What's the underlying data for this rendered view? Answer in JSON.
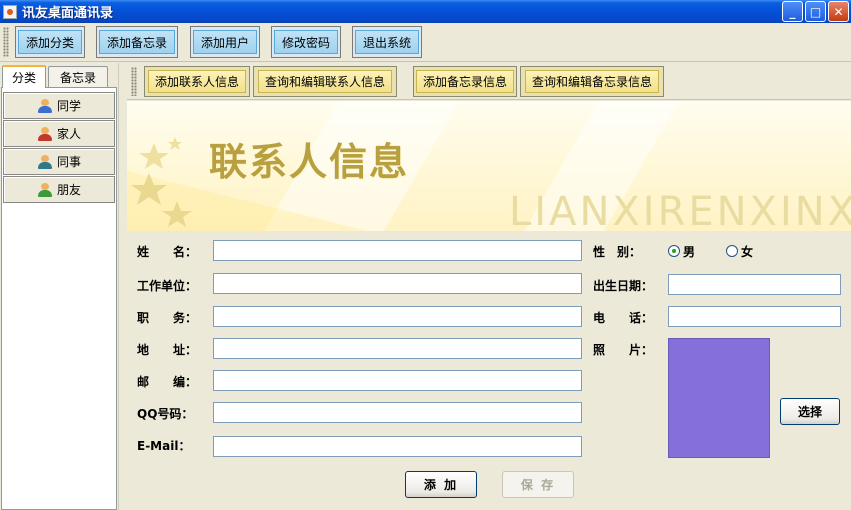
{
  "window": {
    "title": "讯友桌面通讯录",
    "min_label": "_",
    "max_label": "□",
    "close_label": "✕"
  },
  "main_toolbar": {
    "buttons": [
      {
        "label": "添加分类"
      },
      {
        "label": "添加备忘录"
      },
      {
        "label": "添加用户"
      },
      {
        "label": "修改密码"
      },
      {
        "label": "退出系统"
      }
    ]
  },
  "left_panel": {
    "tabs": [
      {
        "label": "分类"
      },
      {
        "label": "备忘录"
      }
    ],
    "categories": [
      {
        "label": "同学",
        "icon": "classmate-icon",
        "color": "#3a6ecf"
      },
      {
        "label": "家人",
        "icon": "family-icon",
        "color": "#c0392b"
      },
      {
        "label": "同事",
        "icon": "colleague-icon",
        "color": "#2f7a8a"
      },
      {
        "label": "朋友",
        "icon": "friend-icon",
        "color": "#3c9a3c"
      }
    ]
  },
  "sub_toolbar": {
    "buttons": [
      {
        "label": "添加联系人信息"
      },
      {
        "label": "查询和编辑联系人信息"
      },
      {
        "label": "添加备忘录信息"
      },
      {
        "label": "查询和编辑备忘录信息"
      }
    ]
  },
  "banner": {
    "title": "联系人信息",
    "pinyin": "LIANXIRENXINXI"
  },
  "form": {
    "name_label": "姓　　名：",
    "name_value": "",
    "company_label": "工作单位：",
    "company_value": "",
    "position_label": "职　　务：",
    "position_value": "",
    "address_label": "地　　址：",
    "address_value": "",
    "zip_label": "邮　　编：",
    "zip_value": "",
    "qq_label": "QQ号码：",
    "qq_value": "",
    "email_label": "E-Mail：",
    "email_value": "",
    "gender_label": "性　别：",
    "gender_options": [
      {
        "label": "男",
        "selected": true
      },
      {
        "label": "女",
        "selected": false
      }
    ],
    "birthday_label": "出生日期：",
    "birthday_value": "",
    "phone_label": "电　　话：",
    "phone_value": "",
    "photo_label": "照　　片：",
    "photo_color": "#8470d8",
    "choose_label": "选择",
    "add_label": "添 加",
    "save_label": "保 存"
  }
}
